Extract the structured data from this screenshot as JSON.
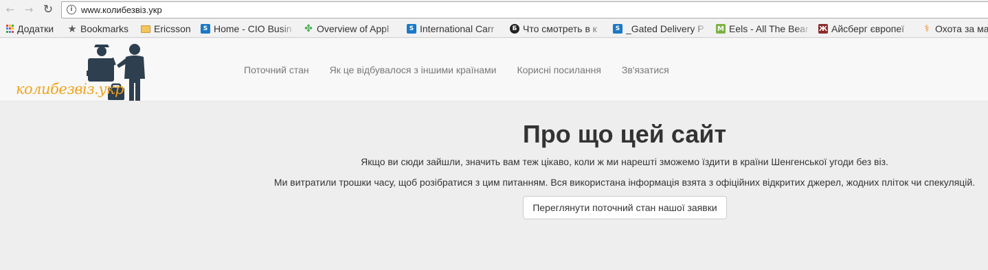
{
  "browser": {
    "address_bar": {
      "url": "www.колибезвіз.укр"
    },
    "bookmarks": [
      {
        "label": "Додатки",
        "icon": "apps-grid-icon"
      },
      {
        "label": "Bookmarks",
        "icon": "star-icon"
      },
      {
        "label": "Ericsson",
        "icon": "folder-icon"
      },
      {
        "label": "Home - CIO Busin",
        "icon": "sharepoint-icon"
      },
      {
        "label": "Overview of Appl",
        "icon": "leaf-icon"
      },
      {
        "label": "International Carr",
        "icon": "sharepoint-icon"
      },
      {
        "label": "Что смотреть в к",
        "icon": "b-circle-icon"
      },
      {
        "label": "_Gated Delivery P",
        "icon": "sharepoint-icon"
      },
      {
        "label": "Eels - All The Bear",
        "icon": "m-icon"
      },
      {
        "label": "Айсберг європеї",
        "icon": "zh-icon"
      },
      {
        "label": "Охота за ма",
        "icon": "flame-icon"
      }
    ]
  },
  "site": {
    "logo_text": "колибезвіз.укр",
    "nav": [
      "Поточний стан",
      "Як це відбувалося з іншими країнами",
      "Корисні посилання",
      "Зв'язатися"
    ]
  },
  "hero": {
    "title": "Про що цей сайт",
    "line1": "Якщо ви сюди зайшли, значить вам теж цікаво, коли ж ми нарешті зможемо їздити в країни Шенгенської угоди без віз.",
    "line2": "Ми витратили трошки часу, щоб розібратися з цим питанням. Вся використана інформація взята з офіційних відкритих джерел, жодних пліток чи спекуляцій.",
    "button": "Переглянути поточний стан нашої заявки"
  },
  "colors": {
    "logo_accent": "#f0a41a",
    "logo_figures": "#2e3f4f",
    "page_bg": "#eeeeee",
    "navbar_bg": "#f8f8f8"
  }
}
